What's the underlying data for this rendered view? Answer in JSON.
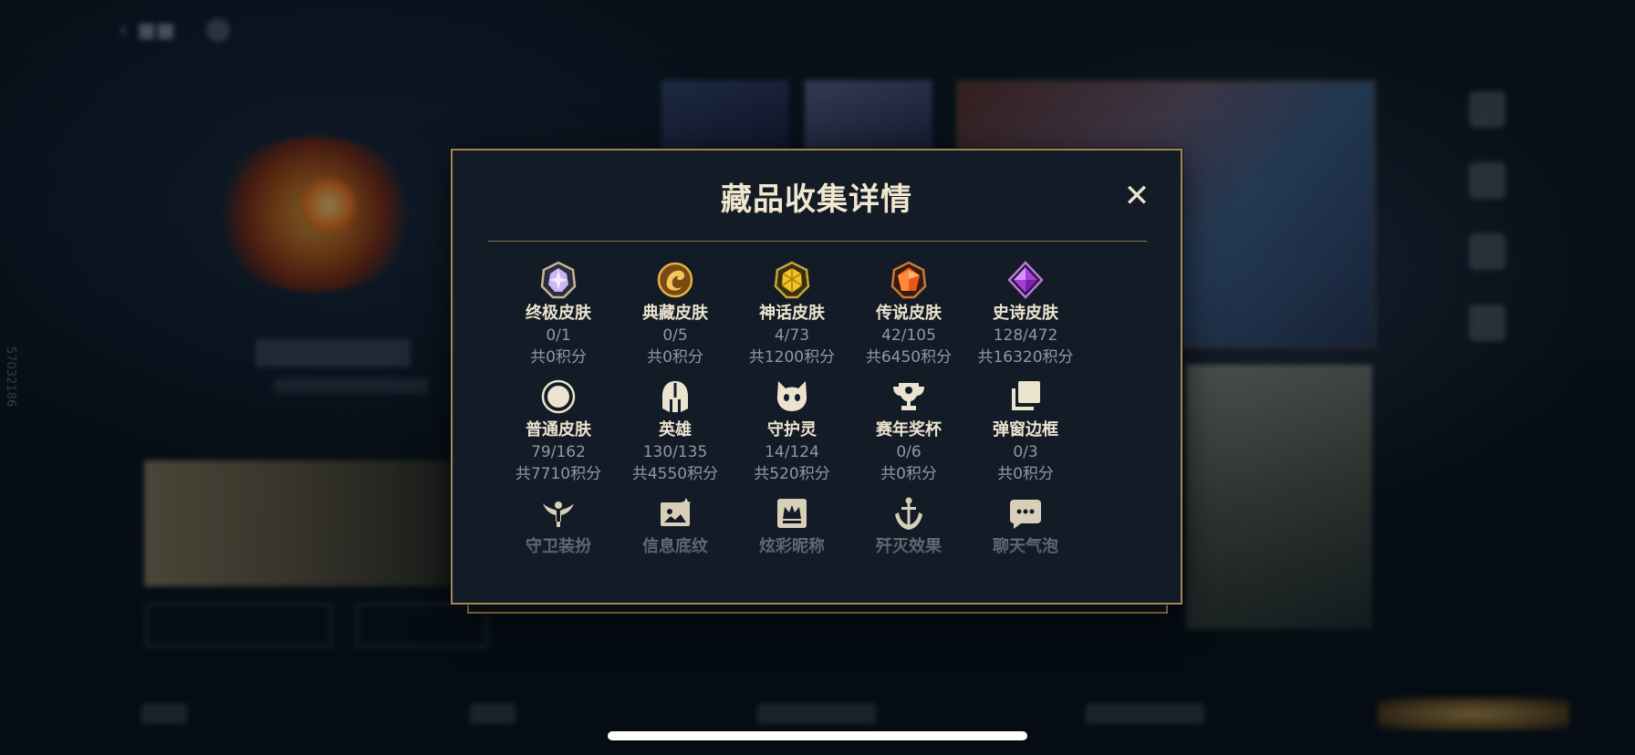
{
  "background": {
    "side_id": "57032186"
  },
  "modal": {
    "title": "藏品收集详情",
    "close_icon": "close-icon",
    "rows": [
      [
        {
          "icon": "ultimate-skin-icon",
          "label": "终极皮肤",
          "count": "0/1",
          "points": "共0积分"
        },
        {
          "icon": "collector-skin-icon",
          "label": "典藏皮肤",
          "count": "0/5",
          "points": "共0积分"
        },
        {
          "icon": "mythic-skin-icon",
          "label": "神话皮肤",
          "count": "4/73",
          "points": "共1200积分"
        },
        {
          "icon": "legendary-skin-icon",
          "label": "传说皮肤",
          "count": "42/105",
          "points": "共6450积分"
        },
        {
          "icon": "epic-skin-icon",
          "label": "史诗皮肤",
          "count": "128/472",
          "points": "共16320积分"
        }
      ],
      [
        {
          "icon": "standard-skin-icon",
          "label": "普通皮肤",
          "count": "79/162",
          "points": "共7710积分"
        },
        {
          "icon": "champion-helmet-icon",
          "label": "英雄",
          "count": "130/135",
          "points": "共4550积分"
        },
        {
          "icon": "companion-icon",
          "label": "守护灵",
          "count": "14/124",
          "points": "共520积分"
        },
        {
          "icon": "trophy-icon",
          "label": "赛年奖杯",
          "count": "0/6",
          "points": "共0积分"
        },
        {
          "icon": "popup-frame-icon",
          "label": "弹窗边框",
          "count": "0/3",
          "points": "共0积分"
        }
      ],
      [
        {
          "icon": "guardian-outfit-icon",
          "label": "守卫装扮"
        },
        {
          "icon": "info-banner-icon",
          "label": "信息底纹"
        },
        {
          "icon": "colorful-nickname-icon",
          "label": "炫彩昵称"
        },
        {
          "icon": "annihilation-effect-icon",
          "label": "歼灭效果"
        },
        {
          "icon": "chat-bubble-icon",
          "label": "聊天气泡"
        }
      ]
    ]
  }
}
